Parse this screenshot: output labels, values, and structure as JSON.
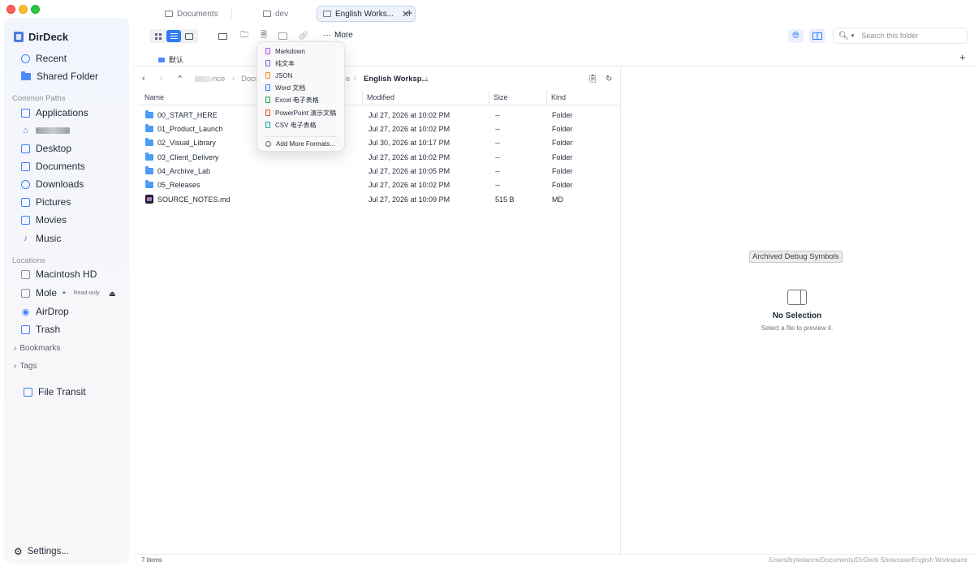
{
  "app": {
    "name": "DirDeck"
  },
  "tabs": [
    {
      "label": "Documents",
      "active": false
    },
    {
      "label": "dev",
      "active": false
    },
    {
      "label": "English Works...",
      "active": true
    }
  ],
  "sidebar": {
    "items_top": [
      {
        "label": "Recent",
        "icon": "clock-icon"
      },
      {
        "label": "Shared Folder",
        "icon": "shared-folder-icon"
      }
    ],
    "common_paths_title": "Common Paths",
    "common_paths": [
      {
        "label": "Applications",
        "icon": "applications-icon"
      },
      {
        "label": "",
        "icon": "home-icon"
      },
      {
        "label": "Desktop",
        "icon": "desktop-icon"
      },
      {
        "label": "Documents",
        "icon": "document-icon"
      },
      {
        "label": "Downloads",
        "icon": "download-icon"
      },
      {
        "label": "Pictures",
        "icon": "pictures-icon"
      },
      {
        "label": "Movies",
        "icon": "movie-icon"
      },
      {
        "label": "Music",
        "icon": "music-icon"
      }
    ],
    "locations_title": "Locations",
    "locations": [
      {
        "label": "Macintosh HD",
        "icon": "disk-icon"
      },
      {
        "label": "Mole",
        "icon": "drive-icon",
        "badge": "Read-only"
      },
      {
        "label": "AirDrop",
        "icon": "airdrop-icon"
      },
      {
        "label": "Trash",
        "icon": "trash-icon"
      }
    ],
    "bookmarks_label": "Bookmarks",
    "tags_label": "Tags",
    "file_transit_label": "File Transit",
    "settings_label": "Settings..."
  },
  "toolbar": {
    "more_label": "More",
    "search_placeholder": "Search this folder"
  },
  "pinbar": {
    "item_label": "默认"
  },
  "breadcrumb": {
    "items": [
      {
        "label": "nce"
      },
      {
        "label": "Docu"
      },
      {
        "label": "e"
      },
      {
        "label": "English Worksp..."
      }
    ]
  },
  "file_table": {
    "columns": [
      "Name",
      "Modified",
      "Size",
      "Kind"
    ],
    "rows": [
      {
        "name": "00_START_HERE",
        "modified": "Jul 27, 2026 at 10:02 PM",
        "size": "--",
        "kind": "Folder",
        "type": "folder"
      },
      {
        "name": "01_Product_Launch",
        "modified": "Jul 27, 2026 at 10:02 PM",
        "size": "--",
        "kind": "Folder",
        "type": "folder"
      },
      {
        "name": "02_Visual_Library",
        "modified": "Jul 30, 2026 at 10:17 PM",
        "size": "--",
        "kind": "Folder",
        "type": "folder"
      },
      {
        "name": "03_Client_Delivery",
        "modified": "Jul 27, 2026 at 10:02 PM",
        "size": "--",
        "kind": "Folder",
        "type": "folder"
      },
      {
        "name": "04_Archive_Lab",
        "modified": "Jul 27, 2026 at 10:05 PM",
        "size": "--",
        "kind": "Folder",
        "type": "folder"
      },
      {
        "name": "05_Releases",
        "modified": "Jul 27, 2026 at 10:02 PM",
        "size": "--",
        "kind": "Folder",
        "type": "folder"
      },
      {
        "name": "SOURCE_NOTES.md",
        "modified": "Jul 27, 2026 at 10:09 PM",
        "size": "515 B",
        "kind": "MD",
        "type": "md"
      }
    ]
  },
  "new_file_menu": {
    "items": [
      {
        "label": "Markdown",
        "color": "#b05be0"
      },
      {
        "label": "纯文本",
        "color": "#7c6fe0"
      },
      {
        "label": "JSON",
        "color": "#e8963a"
      },
      {
        "label": "Word 文档",
        "color": "#3b82f6"
      },
      {
        "label": "Excel 电子表格",
        "color": "#22a84a"
      },
      {
        "label": "PowerPoint 演示文稿",
        "color": "#e5533d"
      },
      {
        "label": "CSV 电子表格",
        "color": "#1fa7a0"
      }
    ],
    "add_more_label": "Add More Formats..."
  },
  "preview": {
    "tooltip": "Archived Debug Symbols",
    "title": "No Selection",
    "subtitle": "Select a file to preview it."
  },
  "status": {
    "item_count": "7 items",
    "path": "/Users/bytedance/Documents/DirDeck Showcase/English Workspace"
  },
  "colors": {
    "accent": "#2f7cf6",
    "folder": "#4b9cf5"
  }
}
